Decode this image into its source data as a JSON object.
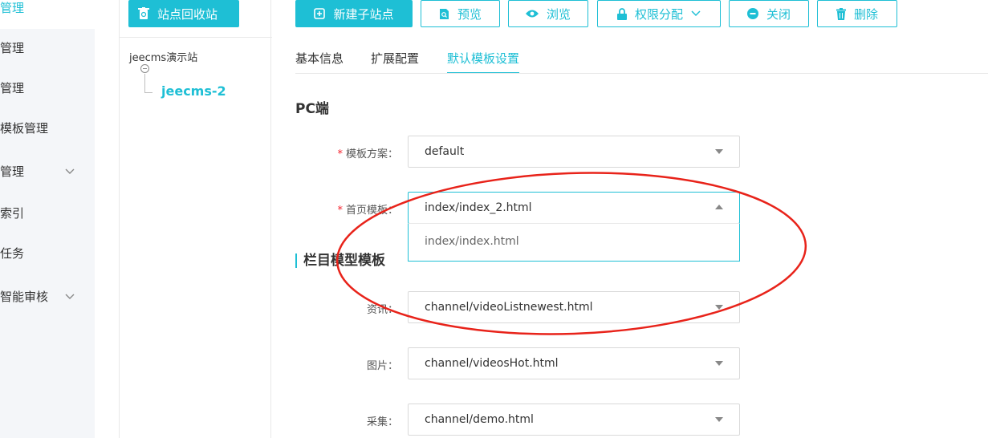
{
  "nav": {
    "items": [
      {
        "label": "管理",
        "active": true
      },
      {
        "label": "管理"
      },
      {
        "label": "管理"
      },
      {
        "label": "模板管理"
      },
      {
        "label": "管理",
        "has_children": true
      },
      {
        "label": "索引"
      },
      {
        "label": "任务"
      },
      {
        "label": "智能审核",
        "has_children": true
      }
    ]
  },
  "tree": {
    "recycle_label": "站点回收站",
    "root_label": "jeecms演示站",
    "child_label": "jeecms-2"
  },
  "toolbar": {
    "new_site": "新建子站点",
    "preview": "预览",
    "browse": "浏览",
    "permission": "权限分配",
    "close": "关闭",
    "delete": "删除"
  },
  "tabs": [
    {
      "label": "基本信息"
    },
    {
      "label": "扩展配置"
    },
    {
      "label": "默认模板设置",
      "active": true
    }
  ],
  "form": {
    "pc_title": "PC端",
    "template_scheme": {
      "label": "模板方案：",
      "value": "default",
      "required": true
    },
    "home_template": {
      "label": "首页模板：",
      "value": "index/index_2.html",
      "required": true,
      "options": [
        "index/index.html"
      ]
    },
    "model_title": "栏目模型模板",
    "news": {
      "label": "资讯：",
      "value": "channel/videoListnewest.html"
    },
    "images": {
      "label": "图片：",
      "value": "channel/videosHot.html"
    },
    "collect": {
      "label": "采集：",
      "value": "channel/demo.html"
    }
  },
  "colors": {
    "accent": "#1ebfd5",
    "annotation": "#e8231a",
    "required": "#f5222d"
  }
}
